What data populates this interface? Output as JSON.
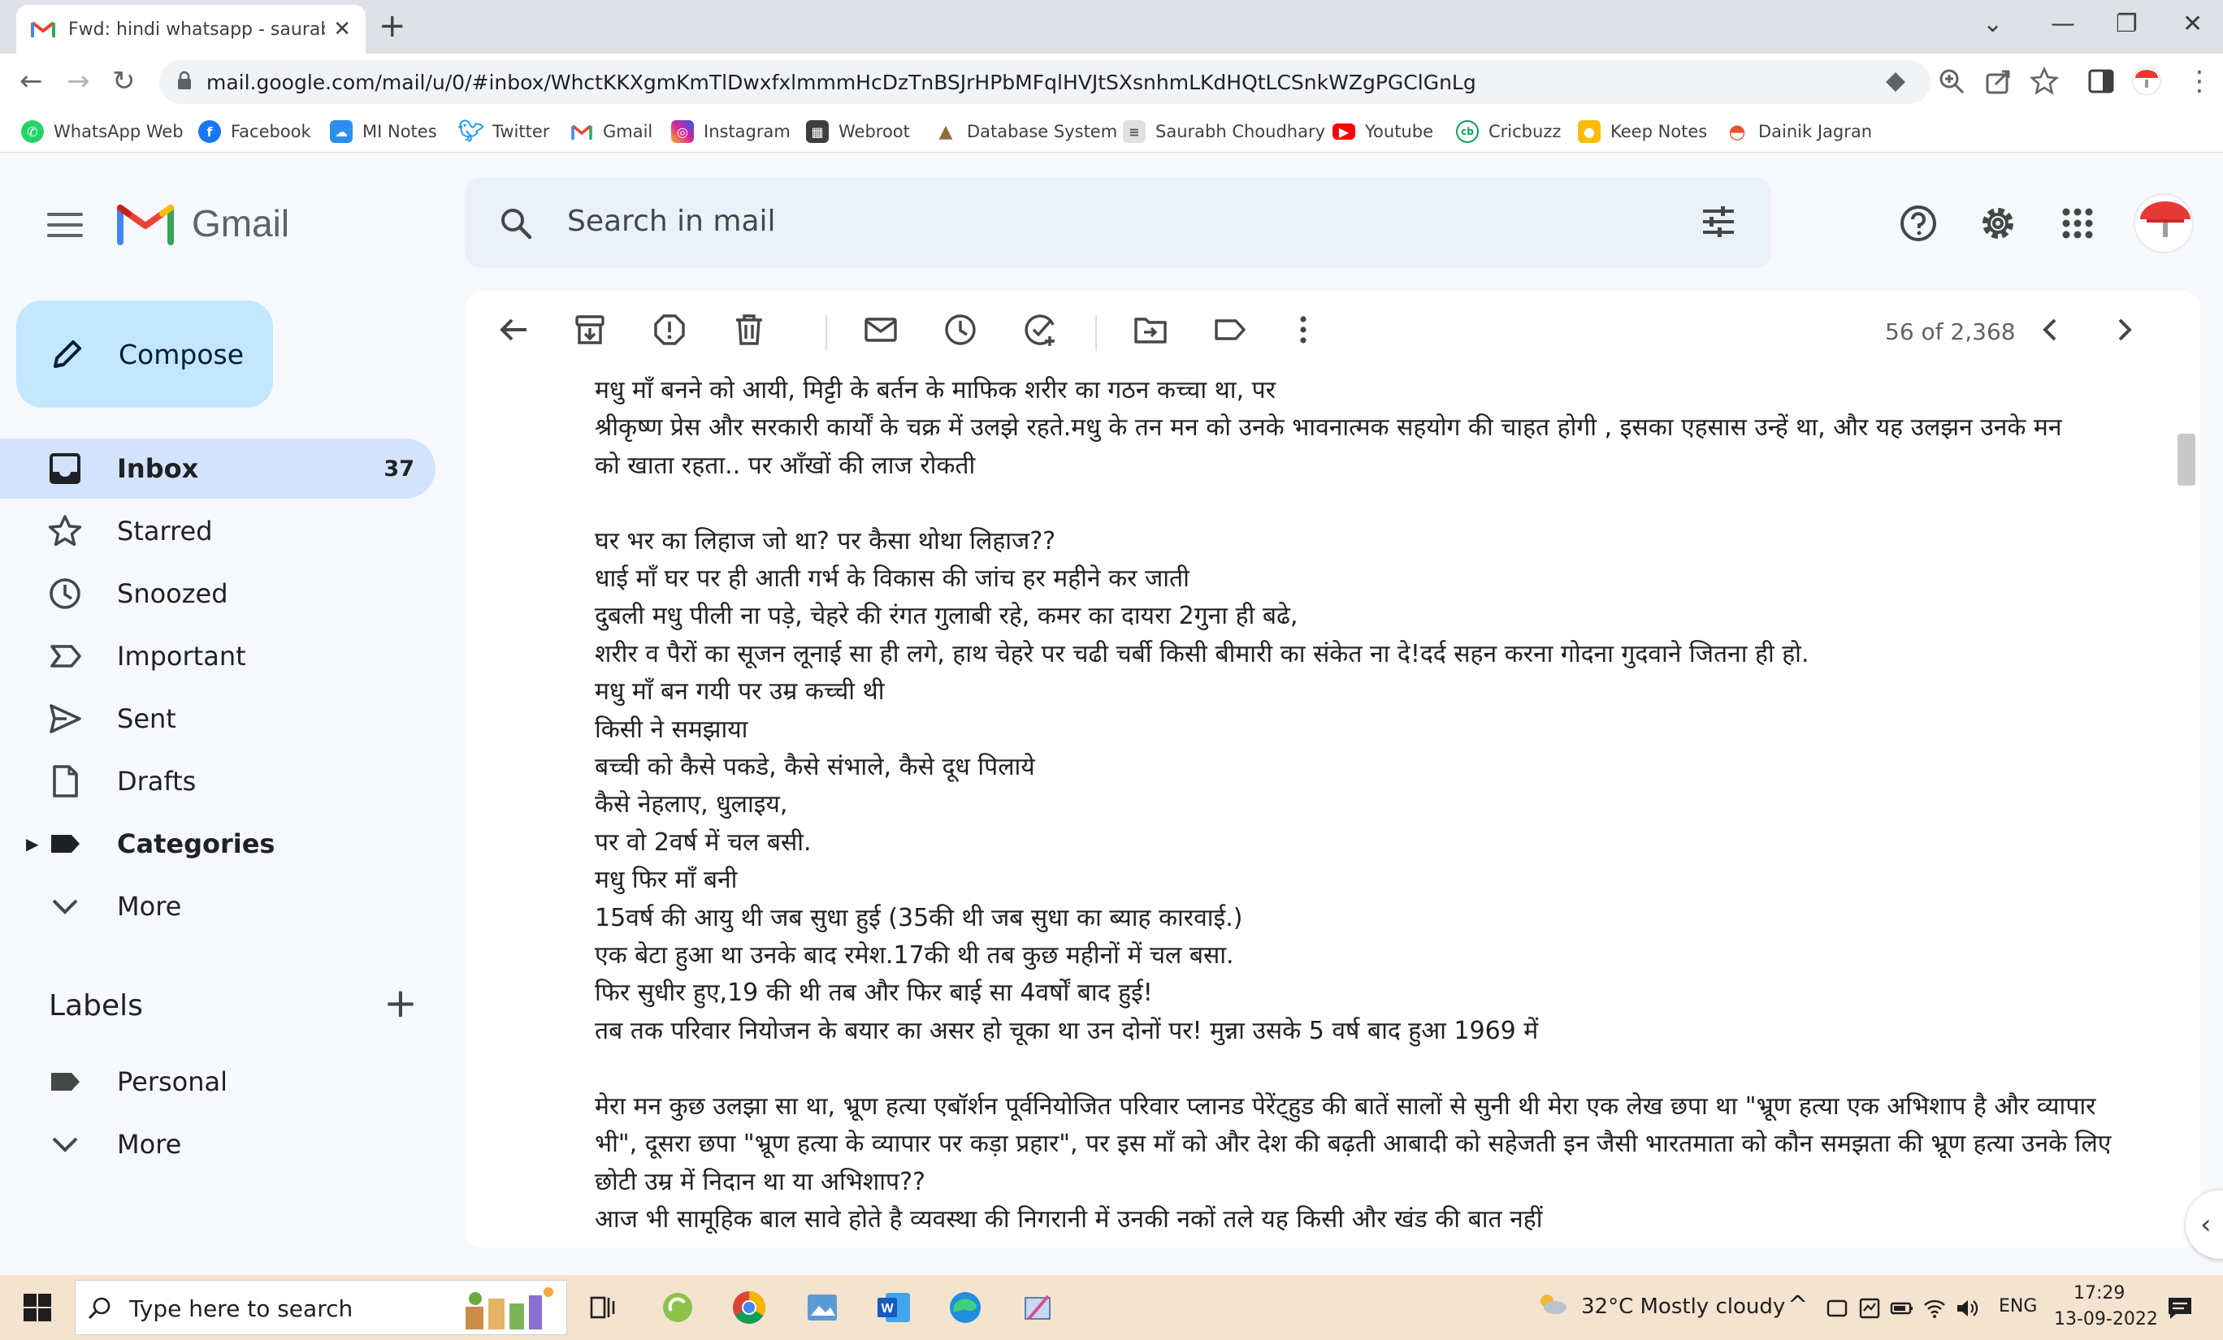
{
  "browser": {
    "tab_title": "Fwd: hindi whatsapp - saurabhch",
    "url": "mail.google.com/mail/u/0/#inbox/WhctKKXgmKmTlDwxfxlmmmHcDzTnBSJrHPbMFqlHVJtSXsnhmLKdHQtLCSnkWZgPGClGnLg"
  },
  "bookmarks": [
    {
      "label": "WhatsApp Web",
      "color": "#25d366"
    },
    {
      "label": "Facebook",
      "color": "#1877f2"
    },
    {
      "label": "MI Notes",
      "color": "#2b8ef0"
    },
    {
      "label": "Twitter",
      "color": "#1d9bf0"
    },
    {
      "label": "Gmail",
      "color": "#ea4335"
    },
    {
      "label": "Instagram",
      "color": "#d6249f"
    },
    {
      "label": "Webroot",
      "color": "#3d3d3d"
    },
    {
      "label": "Database System",
      "color": "#8a6d3b"
    },
    {
      "label": "Saurabh Choudhary",
      "color": "#777777"
    },
    {
      "label": "Youtube",
      "color": "#ff0000"
    },
    {
      "label": "Cricbuzz",
      "color": "#0a9e5c"
    },
    {
      "label": "Keep Notes",
      "color": "#fbbc04"
    },
    {
      "label": "Dainik Jagran",
      "color": "#e8542a"
    }
  ],
  "gmail": {
    "brand": "Gmail",
    "search_placeholder": "Search in mail",
    "compose_label": "Compose",
    "nav": [
      {
        "label": "Inbox",
        "count": "37",
        "icon": "inbox-icon"
      },
      {
        "label": "Starred",
        "icon": "star-icon"
      },
      {
        "label": "Snoozed",
        "icon": "clock-icon"
      },
      {
        "label": "Important",
        "icon": "important-icon"
      },
      {
        "label": "Sent",
        "icon": "send-icon"
      },
      {
        "label": "Drafts",
        "icon": "draft-icon"
      },
      {
        "label": "Categories",
        "icon": "label-icon"
      },
      {
        "label": "More",
        "icon": "chevron-down-icon"
      }
    ],
    "labels_title": "Labels",
    "labels": [
      {
        "label": "Personal",
        "icon": "label-icon"
      },
      {
        "label": "More",
        "icon": "chevron-down-icon"
      }
    ],
    "pager": "56 of 2,368"
  },
  "message": {
    "lines": [
      "मधु माँ बनने को आयी, मिट्टी के बर्तन के माफिक शरीर का गठन कच्चा था, पर",
      "      श्रीकृष्ण प्रेस और सरकारी कार्यों के चक्र में उलझे रहते.मधु के तन मन को उनके भावनात्मक सहयोग की चाहत होगी , इसका एहसास उन्हें था, और यह उलझन उनके मन",
      "को खाता रहता.. पर आँखों की लाज रोकती",
      "",
      " घर भर का लिहाज जो था? पर कैसा थोथा लिहाज??",
      "धाई माँ घर पर ही आती गर्भ के विकास की जांच हर महीने कर जाती",
      "दुबली मधु पीली ना पड़े, चेहरे की रंगत गुलाबी रहे, कमर का दायरा 2गुना ही बढे,",
      "शरीर व पैरों का सूजन लूनाई सा ही लगे, हाथ चेहरे पर चढी चर्बी किसी बीमारी का संकेत ना दे!दर्द सहन करना गोदना गुदवाने जितना ही हो.",
      "मधु माँ बन गयी पर उम्र कच्ची थी",
      "किसी ने समझाया",
      "बच्ची को कैसे पकडे, कैसे संभाले, कैसे दूध पिलाये",
      "कैसे नेहलाए, धुलाइय,",
      "पर वो 2वर्ष में चल बसी.",
      "मधु फिर माँ बनी",
      "15वर्ष की आयु थी जब सुधा हुई (35की थी जब सुधा का ब्याह कारवाई.)",
      "एक बेटा हुआ था उनके बाद रमेश.17की थी तब कुछ महीनों में चल बसा.",
      "फिर सुधीर हुए,19 की थी तब और फिर बाई सा 4वर्षों बाद हुई!",
      "तब तक परिवार नियोजन के बयार का असर हो चूका था उन दोनों पर! मुन्ना उसके 5 वर्ष बाद हुआ 1969 में",
      "",
      "मेरा मन कुछ उलझा सा था, भ्रूण हत्या एबॉर्शन पूर्वनियोजित परिवार प्लानड पेरेंट्हुड की बातें सालों से सुनी थी मेरा एक लेख छपा था \"भ्रूण हत्या एक अभिशाप है और व्यापार",
      "भी\", दूसरा छपा \"भ्रूण हत्या के व्यापार पर कड़ा प्रहार\", पर इस माँ को और देश की बढ़ती आबादी को सहेजती इन जैसी भारतमाता को कौन समझता की भ्रूण हत्या उनके लिए",
      "छोटी उम्र में निदान था या अभिशाप??",
      "आज भी सामूहिक बाल सावे होते है व्यवस्था की निगरानी में उनकी नकों तले यह किसी और खंड की बात नहीं"
    ]
  },
  "taskbar": {
    "search_placeholder": "Type here to search",
    "weather": "32°C  Mostly cloudy",
    "lang": "ENG",
    "time": "17:29",
    "date": "13-09-2022"
  }
}
